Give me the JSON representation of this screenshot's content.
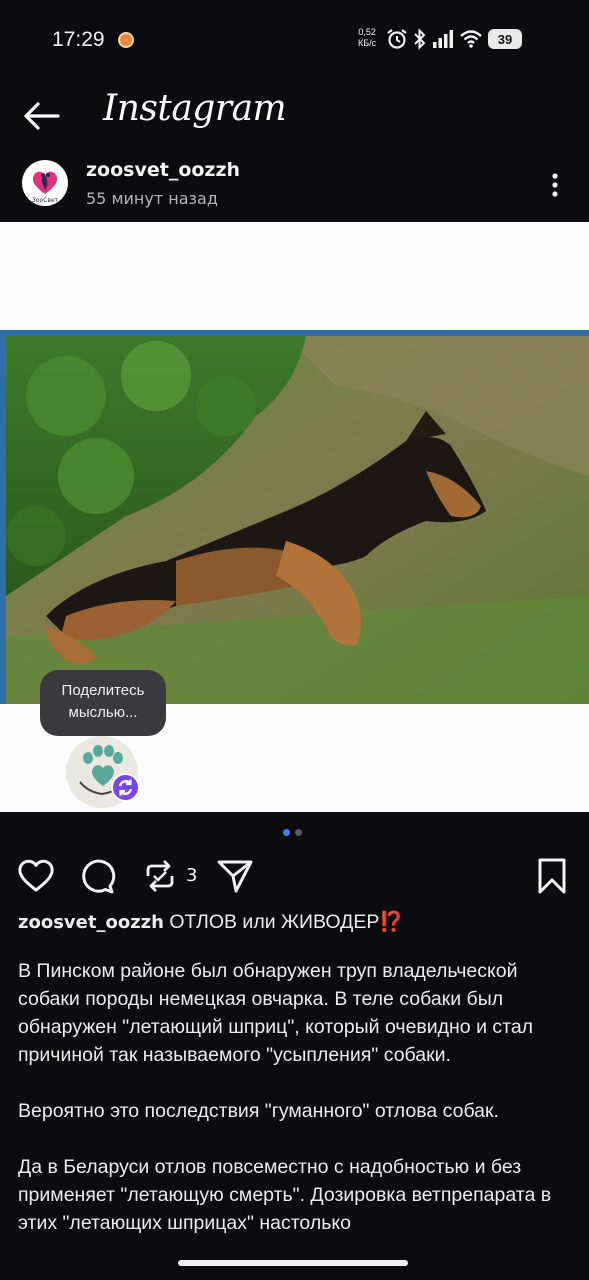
{
  "status_bar": {
    "time": "17:29",
    "net_speed_value": "0,52",
    "net_speed_unit": "КБ/с",
    "battery": "39",
    "icons": [
      "alarm-icon",
      "bluetooth-icon",
      "signal-icon",
      "wifi-icon",
      "battery-icon"
    ]
  },
  "header": {
    "title": "Instagram",
    "back_icon": "back-arrow-icon"
  },
  "post": {
    "username": "zoosvet_oozzh",
    "time_ago": "55 минут назад",
    "avatar_text": "ЗооСвет"
  },
  "media": {
    "share_prompt_line1": "Поделитесь",
    "share_prompt_line2": "мыслью...",
    "carousel": {
      "current": 1,
      "total": 2
    }
  },
  "actions": {
    "repost_count": "3",
    "icons": [
      "heart-icon",
      "comment-icon",
      "repost-icon",
      "share-icon",
      "bookmark-icon"
    ]
  },
  "caption": {
    "username": "zoosvet_oozzh",
    "headline": "ОТЛОВ или ЖИВОДЕР⁉️",
    "paragraphs": [
      "В Пинском районе был обнаружен труп владельческой собаки породы немецкая овчарка. В теле собаки был обнаружен \"летающий шприц\", который очевидно и стал причиной так называемого \"усыпления\" собаки.",
      "Вероятно это последствия \"гуманного\" отлова собак.",
      "Да в Беларуси отлов повсеместно с надобностью и без применяет \"летающую смерть\". Дозировка ветпрепарата в этих \"летающих шприцах\" настолько"
    ]
  },
  "colors": {
    "background": "#0b0b10",
    "active_dot": "#4a7cf0",
    "inactive_dot": "#5a5a62",
    "badge": "#7a44e6",
    "share_bubble": "#3a3a3e"
  }
}
